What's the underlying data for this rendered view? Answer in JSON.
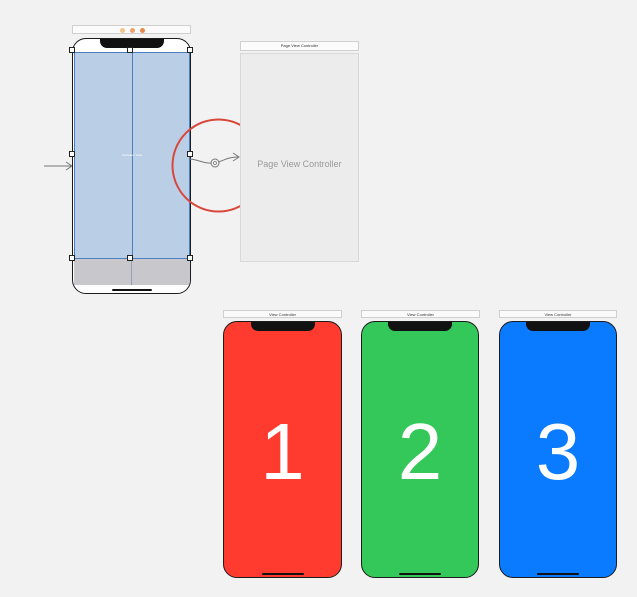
{
  "scenes": {
    "root": {
      "toolbar_title": "",
      "selected_view_label": "Container View",
      "dot_colors": [
        "#f6c48b",
        "#f0a06a",
        "#e6884a"
      ]
    },
    "page_view_controller": {
      "toolbar_title": "Page View Controller",
      "center_label": "Page View Controller"
    },
    "view_controllers": [
      {
        "toolbar_title": "View Controller",
        "number": "1",
        "color": "#ff3b30"
      },
      {
        "toolbar_title": "View Controller",
        "number": "2",
        "color": "#34c759"
      },
      {
        "toolbar_title": "View Controller",
        "number": "3",
        "color": "#0a7aff"
      }
    ]
  },
  "colors": {
    "canvas_bg": "#f2f2f2",
    "container_fill": "#bacfe6",
    "highlight_circle": "#d9473b",
    "tabbar_gray": "#c8c7cc"
  }
}
